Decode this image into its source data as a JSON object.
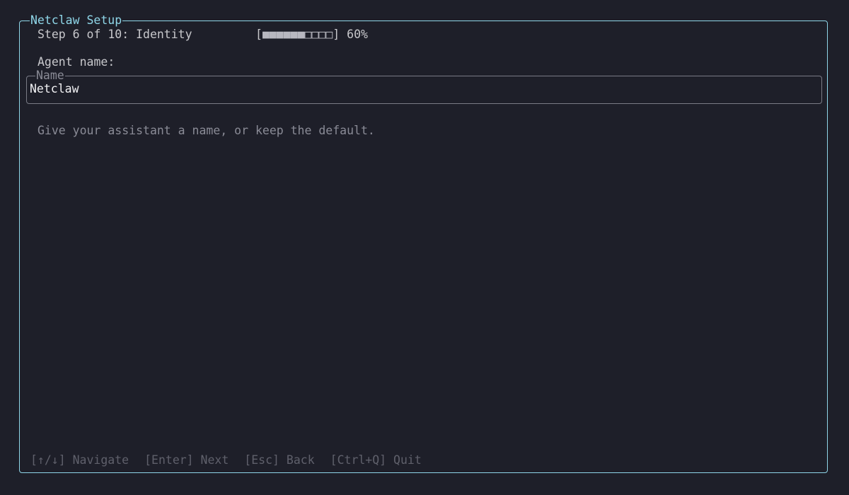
{
  "window": {
    "title": "Netclaw Setup"
  },
  "step": {
    "label": "Step 6 of 10: Identity",
    "progress": {
      "open": "[",
      "filled": "■■■■■■",
      "empty": "□□□□",
      "close": "]",
      "percent_text": "60%",
      "fraction": 0.6
    }
  },
  "form": {
    "prompt": "Agent name:",
    "field_legend": "Name",
    "field_value": "Netclaw",
    "hint": "Give your assistant a name, or keep the default."
  },
  "footer": {
    "navigate": "[↑/↓] Navigate",
    "next": "[Enter] Next",
    "back": "[Esc] Back",
    "quit": "[Ctrl+Q] Quit"
  },
  "colors": {
    "background": "#1e1f29",
    "accent": "#8fd6e8",
    "text": "#c8c8cc",
    "muted": "#8a8b96",
    "footer": "#5f606b"
  }
}
